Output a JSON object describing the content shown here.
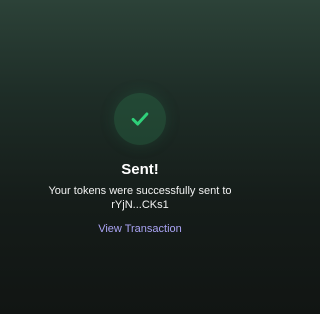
{
  "status": {
    "icon": "checkmark-icon",
    "title": "Sent!",
    "message_line1": "Your tokens were successfully sent to",
    "recipient_address": "rYjN...CKs1",
    "view_link_label": "View Transaction"
  },
  "colors": {
    "accent_green": "#2fd17a",
    "link_purple": "#a9a3f3",
    "background_top": "#2c4238",
    "background_bottom": "#111513"
  }
}
